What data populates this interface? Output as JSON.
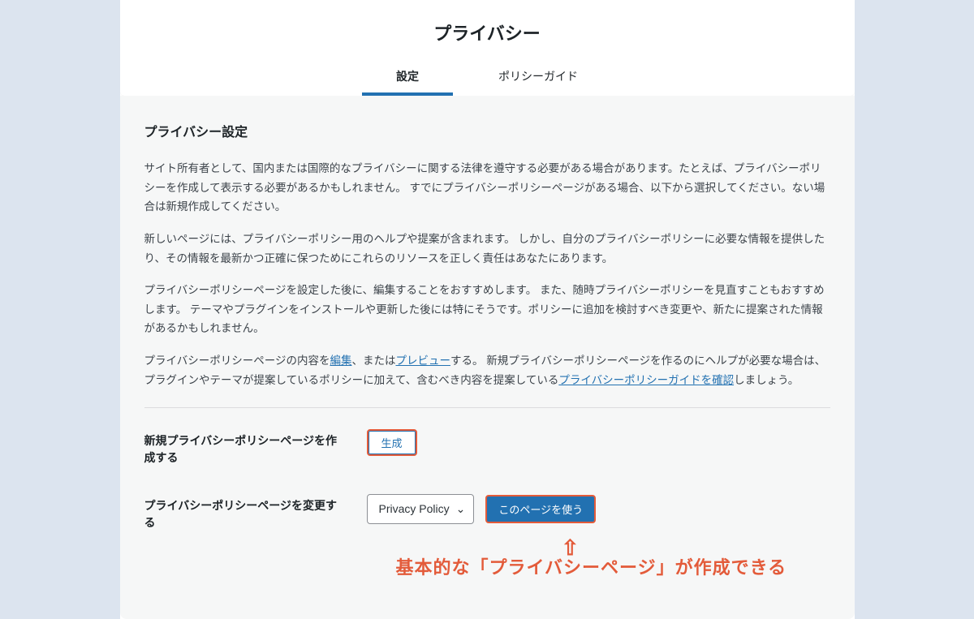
{
  "header": {
    "title": "プライバシー",
    "tabs": [
      {
        "label": "設定",
        "active": true
      },
      {
        "label": "ポリシーガイド",
        "active": false
      }
    ]
  },
  "content": {
    "section_title": "プライバシー設定",
    "paragraphs": {
      "p1": "サイト所有者として、国内または国際的なプライバシーに関する法律を遵守する必要がある場合があります。たとえば、プライバシーポリシーを作成して表示する必要があるかもしれません。 すでにプライバシーポリシーページがある場合、以下から選択してください。ない場合は新規作成してください。",
      "p2": "新しいページには、プライバシーポリシー用のヘルプや提案が含まれます。 しかし、自分のプライバシーポリシーに必要な情報を提供したり、その情報を最新かつ正確に保つためにこれらのリソースを正しく責任はあなたにあります。",
      "p3": "プライバシーポリシーページを設定した後に、編集することをおすすめします。 また、随時プライバシーポリシーを見直すこともおすすめします。 テーマやプラグインをインストールや更新した後には特にそうです。ポリシーに追加を検討すべき変更や、新たに提案された情報があるかもしれません。",
      "p4_pre": "プライバシーポリシーページの内容を",
      "p4_link1": "編集",
      "p4_mid1": "、または",
      "p4_link2": "プレビュー",
      "p4_mid2": "する。 新規プライバシーポリシーページを作るのにヘルプが必要な場合は、プラグインやテーマが提案しているポリシーに加えて、含むべき内容を提案している",
      "p4_link3": "プライバシーポリシーガイドを確認",
      "p4_post": "しましょう。"
    },
    "form": {
      "create_label": "新規プライバシーポリシーページを作成する",
      "create_button": "生成",
      "change_label": "プライバシーポリシーページを変更する",
      "select_value": "Privacy Policy",
      "use_button": "このページを使う"
    }
  },
  "annotation": {
    "arrow": "⇧",
    "text": "基本的な「プライバシーページ」が作成できる"
  }
}
